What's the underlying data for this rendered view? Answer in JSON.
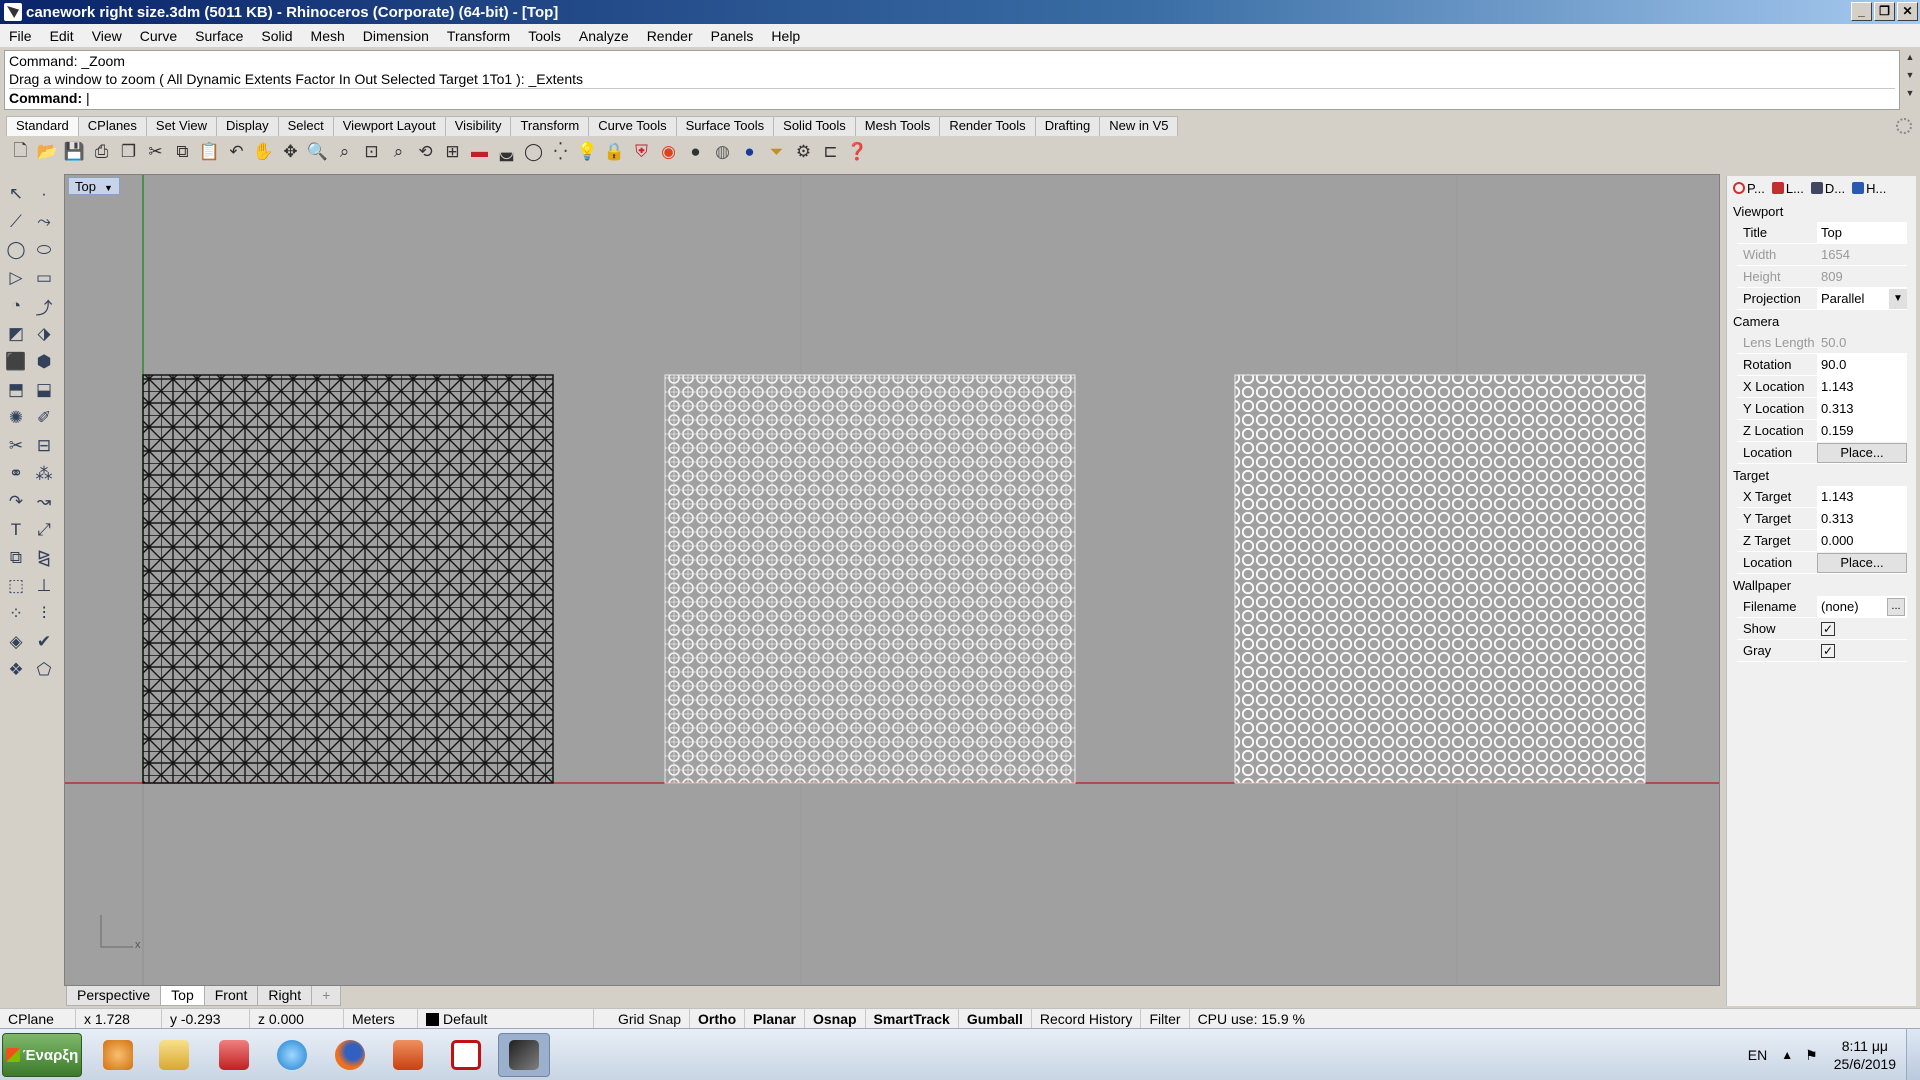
{
  "window": {
    "title": "canework right size.3dm (5011 KB) - Rhinoceros (Corporate) (64-bit) - [Top]",
    "minimize": "_",
    "restore": "❐",
    "close": "✕"
  },
  "menu": [
    "File",
    "Edit",
    "View",
    "Curve",
    "Surface",
    "Solid",
    "Mesh",
    "Dimension",
    "Transform",
    "Tools",
    "Analyze",
    "Render",
    "Panels",
    "Help"
  ],
  "command": {
    "history1": "Command: _Zoom",
    "history2": "Drag a window to zoom ( All  Dynamic  Extents  Factor  In  Out  Selected  Target  1To1 ): _Extents",
    "prompt": "Command:"
  },
  "toolbar_tabs": [
    "Standard",
    "CPlanes",
    "Set View",
    "Display",
    "Select",
    "Viewport Layout",
    "Visibility",
    "Transform",
    "Curve Tools",
    "Surface Tools",
    "Solid Tools",
    "Mesh Tools",
    "Render Tools",
    "Drafting",
    "New in V5"
  ],
  "viewport": {
    "name": "Top",
    "tabs": [
      "Perspective",
      "Top",
      "Front",
      "Right"
    ],
    "add_tab": "+",
    "axis_label": "x"
  },
  "status": {
    "cplane": "CPlane",
    "x": "x 1.728",
    "y": "y -0.293",
    "z": "z 0.000",
    "units": "Meters",
    "layer": "Default",
    "grid_snap": "Grid Snap",
    "ortho": "Ortho",
    "planar": "Planar",
    "osnap": "Osnap",
    "smarttrack": "SmartTrack",
    "gumball": "Gumball",
    "record_history": "Record History",
    "filter": "Filter",
    "cpu": "CPU use: 15.9 %"
  },
  "panel": {
    "tabs": [
      "P...",
      "L...",
      "D...",
      "H..."
    ],
    "viewport_section": "Viewport",
    "title_k": "Title",
    "title_v": "Top",
    "width_k": "Width",
    "width_v": "1654",
    "height_k": "Height",
    "height_v": "809",
    "projection_k": "Projection",
    "projection_v": "Parallel",
    "camera_section": "Camera",
    "lens_k": "Lens Length",
    "lens_v": "50.0",
    "rotation_k": "Rotation",
    "rotation_v": "90.0",
    "xloc_k": "X Location",
    "xloc_v": "1.143",
    "yloc_k": "Y Location",
    "yloc_v": "0.313",
    "zloc_k": "Z Location",
    "zloc_v": "0.159",
    "location_k": "Location",
    "place": "Place...",
    "target_section": "Target",
    "xt_k": "X Target",
    "xt_v": "1.143",
    "yt_k": "Y Target",
    "yt_v": "0.313",
    "zt_k": "Z Target",
    "zt_v": "0.000",
    "wallpaper_section": "Wallpaper",
    "filename_k": "Filename",
    "filename_v": "(none)",
    "dots": "...",
    "show_k": "Show",
    "gray_k": "Gray",
    "checkmark": "✓"
  },
  "taskbar": {
    "start": "Έναρξη",
    "lang": "EN",
    "time": "8:11 μμ",
    "date": "25/6/2019"
  },
  "colors": {
    "viewport_bg": "#a0a0a0",
    "x_axis": "#b03030",
    "y_axis": "#2e8b2e"
  }
}
